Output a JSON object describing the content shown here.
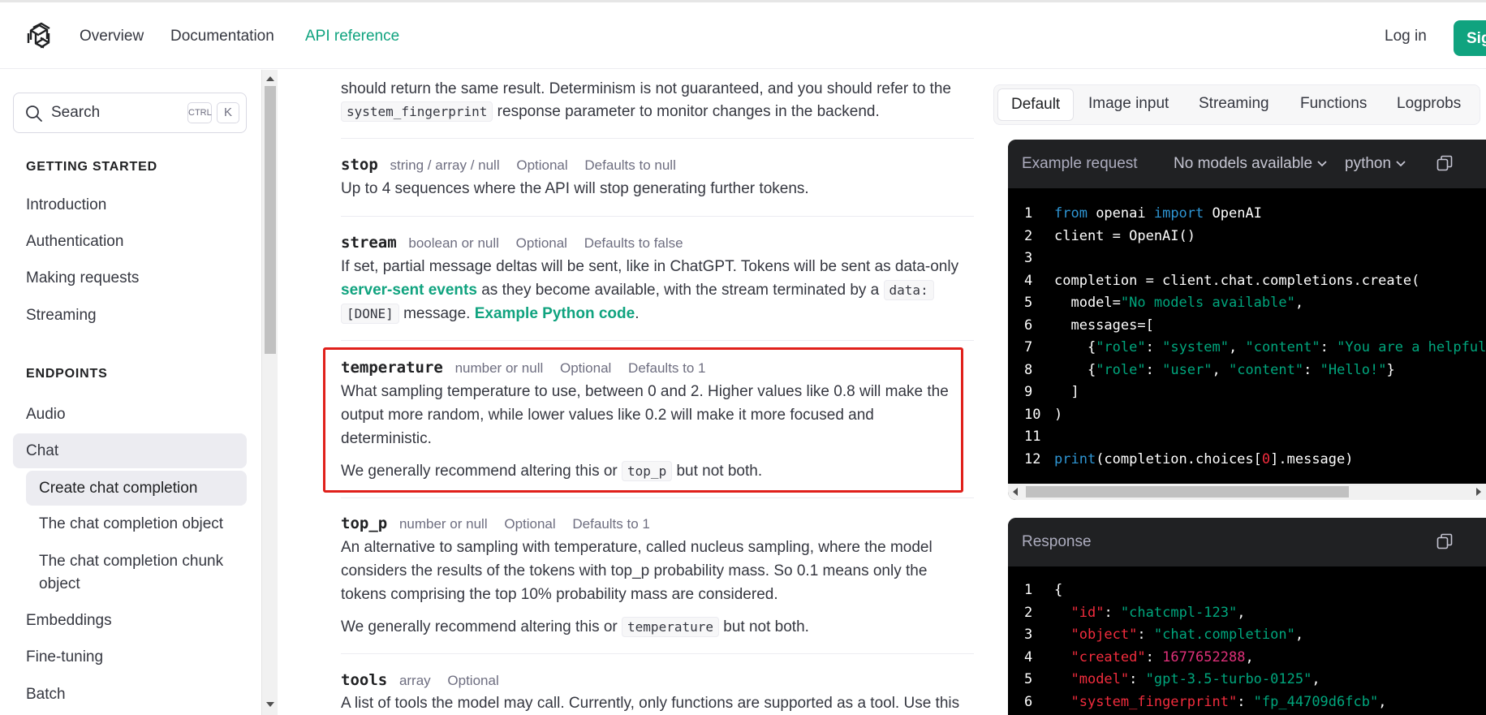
{
  "header": {
    "nav": [
      "Overview",
      "Documentation",
      "API reference"
    ],
    "active_nav": "API reference",
    "login": "Log in",
    "signup": "Sig"
  },
  "sidebar": {
    "search_placeholder": "Search",
    "kbd_ctrl": "CTRL",
    "kbd_k": "K",
    "getting_started_heading": "GETTING STARTED",
    "getting_started": [
      "Introduction",
      "Authentication",
      "Making requests",
      "Streaming"
    ],
    "endpoints_heading": "ENDPOINTS",
    "endpoints": [
      "Audio",
      "Chat"
    ],
    "chat_sub": [
      "Create chat completion",
      "The chat completion object",
      "The chat completion chunk object"
    ],
    "more": [
      "Embeddings",
      "Fine-tuning",
      "Batch"
    ]
  },
  "content": {
    "seed_tail": {
      "line1": "should return the same result. Determinism is not guaranteed, and you should refer to the",
      "code": "system_fingerprint",
      "line2_rest": "response parameter to monitor changes in the backend."
    },
    "params": [
      {
        "name": "stop",
        "type": "string / array / null",
        "optional": "Optional",
        "default": "Defaults to null",
        "desc": "Up to 4 sequences where the API will stop generating further tokens."
      },
      {
        "name": "stream",
        "type": "boolean or null",
        "optional": "Optional",
        "default": "Defaults to false",
        "desc_a": "If set, partial message deltas will be sent, like in ChatGPT. Tokens will be sent as data-only",
        "link1": "server-sent events",
        "desc_b": "as they become available, with the stream terminated by a",
        "code1": "data:",
        "code2": "[DONE]",
        "desc_c": "message.",
        "link2": "Example Python code",
        "desc_d": "."
      },
      {
        "name": "temperature",
        "type": "number or null",
        "optional": "Optional",
        "default": "Defaults to 1",
        "desc_l1": "What sampling temperature to use, between 0 and 2. Higher values like 0.8 will make the",
        "desc_l2": "output more random, while lower values like 0.2 will make it more focused and",
        "desc_l3": "deterministic.",
        "rec_a": "We generally recommend altering this or",
        "rec_code": "top_p",
        "rec_b": "but not both."
      },
      {
        "name": "top_p",
        "type": "number or null",
        "optional": "Optional",
        "default": "Defaults to 1",
        "desc_l1": "An alternative to sampling with temperature, called nucleus sampling, where the model",
        "desc_l2": "considers the results of the tokens with top_p probability mass. So 0.1 means only the",
        "desc_l3": "tokens comprising the top 10% probability mass are considered.",
        "rec_a": "We generally recommend altering this or",
        "rec_code": "temperature",
        "rec_b": "but not both."
      },
      {
        "name": "tools",
        "type": "array",
        "optional": "Optional",
        "desc_l1": "A list of tools the model may call. Currently, only functions are supported as a tool. Use this"
      }
    ]
  },
  "right": {
    "tabs": [
      "Default",
      "Image input",
      "Streaming",
      "Functions",
      "Logprobs"
    ],
    "active_tab": "Default",
    "request": {
      "title": "Example request",
      "model_dd": "No models available",
      "lang_dd": "python"
    },
    "response": {
      "title": "Response"
    }
  },
  "colors": {
    "accent": "#10a37f",
    "highlight_box": "#e0201b",
    "code_bg": "#000000",
    "code_keyword": "#2e95d3",
    "code_string": "#00a67d",
    "code_number": "#df3079"
  }
}
